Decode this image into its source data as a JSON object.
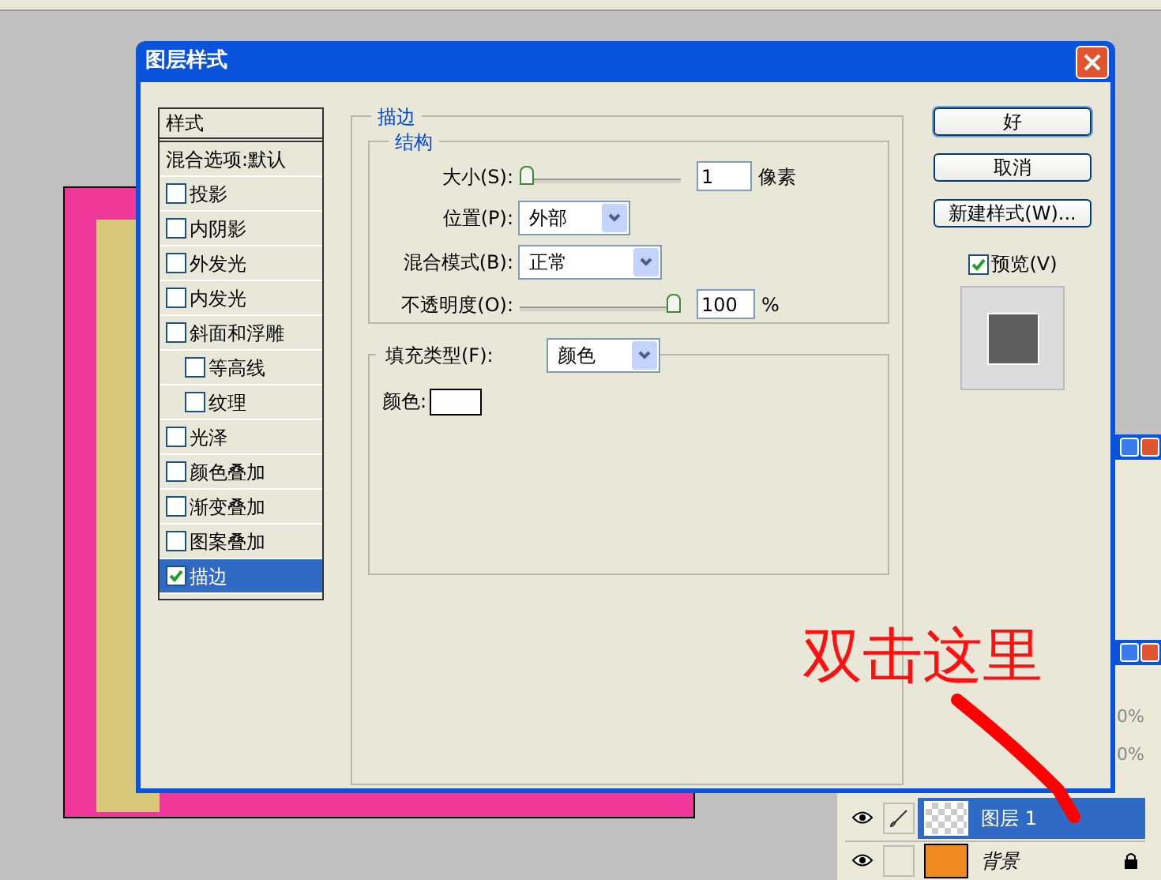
{
  "window": {
    "title": "图层样式"
  },
  "styles_list": {
    "header": "样式",
    "items": [
      {
        "label": "混合选项:默认",
        "kind": "plain",
        "selected": false
      },
      {
        "label": "投影",
        "kind": "checkbox",
        "checked": false,
        "selected": false
      },
      {
        "label": "内阴影",
        "kind": "checkbox",
        "checked": false,
        "selected": false
      },
      {
        "label": "外发光",
        "kind": "checkbox",
        "checked": false,
        "selected": false
      },
      {
        "label": "内发光",
        "kind": "checkbox",
        "checked": false,
        "selected": false
      },
      {
        "label": "斜面和浮雕",
        "kind": "checkbox",
        "checked": false,
        "selected": false,
        "children": [
          {
            "label": "等高线",
            "kind": "checkbox",
            "checked": false,
            "selected": false
          },
          {
            "label": "纹理",
            "kind": "checkbox",
            "checked": false,
            "selected": false
          }
        ]
      },
      {
        "label": "光泽",
        "kind": "checkbox",
        "checked": false,
        "selected": false
      },
      {
        "label": "颜色叠加",
        "kind": "checkbox",
        "checked": false,
        "selected": false
      },
      {
        "label": "渐变叠加",
        "kind": "checkbox",
        "checked": false,
        "selected": false
      },
      {
        "label": "图案叠加",
        "kind": "checkbox",
        "checked": false,
        "selected": false
      },
      {
        "label": "描边",
        "kind": "checkbox",
        "checked": true,
        "selected": true
      }
    ]
  },
  "stroke": {
    "title": "描边",
    "structure": {
      "title": "结构",
      "size": {
        "label": "大小(S):",
        "level": 0,
        "value": "1",
        "unit": "像素"
      },
      "position": {
        "label": "位置(P):",
        "value": "外部"
      },
      "blend_mode": {
        "label": "混合模式(B):",
        "value": "正常"
      },
      "opacity": {
        "label": "不透明度(O):",
        "level": 1,
        "value": "100",
        "unit": "%"
      }
    },
    "fill": {
      "type_label": "填充类型(F):",
      "type_value": "颜色",
      "color_label": "颜色:",
      "color": "#ffffff"
    }
  },
  "buttons": [
    "好",
    "取消",
    "新建样式(W)..."
  ],
  "preview": {
    "label": "预览(V)",
    "checked": true
  },
  "panel_fragments": [
    "0%",
    "0%"
  ],
  "layers": [
    {
      "name": "图层 1",
      "selected": true,
      "visible": true,
      "locked": false
    },
    {
      "name": "背景",
      "selected": false,
      "visible": true,
      "locked": true
    }
  ],
  "annotation": "双击这里"
}
